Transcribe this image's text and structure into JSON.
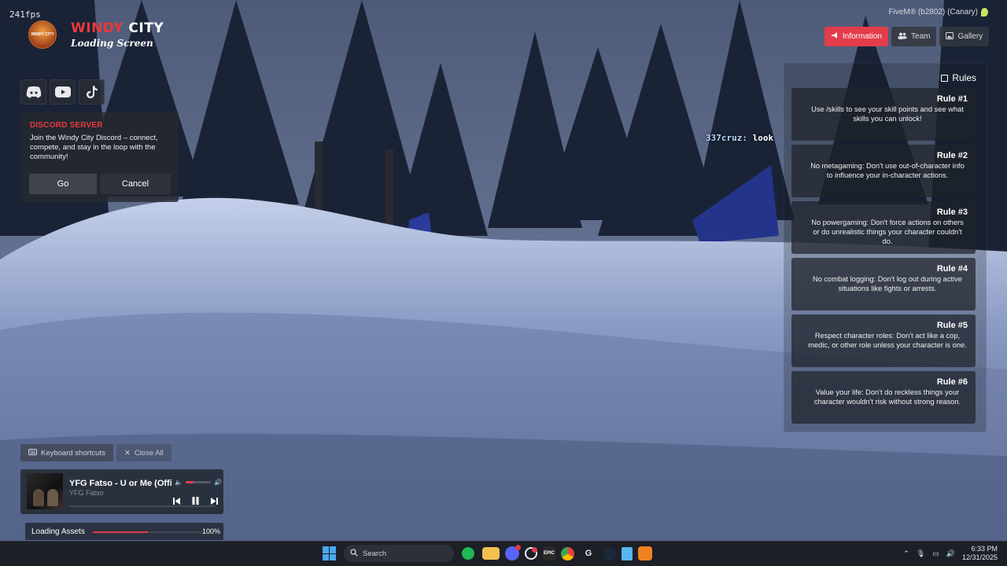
{
  "hud": {
    "fps": "241fps"
  },
  "brand": {
    "logo_text": "WINDY CITY",
    "title_part1": "WINDY",
    "title_part2": " CITY",
    "subtitle": "Loading Screen"
  },
  "socials": [
    "discord-icon",
    "youtube-icon",
    "tiktok-icon"
  ],
  "discord_card": {
    "heading": "DISCORD SERVER",
    "body": "Join the Windy City Discord – connect, compete, and stay in the loop with the community!",
    "go_label": "Go",
    "cancel_label": "Cancel"
  },
  "chat": {
    "name": "337cruz:",
    "message": "look"
  },
  "window": {
    "title": "FiveM® (b2802) (Canary)"
  },
  "tabs": [
    {
      "label": "Information",
      "icon": "megaphone-icon",
      "active": true
    },
    {
      "label": "Team",
      "icon": "users-icon",
      "active": false
    },
    {
      "label": "Gallery",
      "icon": "image-icon",
      "active": false
    }
  ],
  "rules": {
    "title": "Rules",
    "items": [
      {
        "title": "Rule #1",
        "text": "Use /skills to see your skill points and see what skills you can unlock!"
      },
      {
        "title": "Rule #2",
        "text": "No metagaming: Don't use out-of-character info to influence your in-character actions."
      },
      {
        "title": "Rule #3",
        "text": "No powergaming: Don't force actions on others or do unrealistic things your character couldn't do."
      },
      {
        "title": "Rule #4",
        "text": "No combat logging: Don't log out during active situations like fights or arrests."
      },
      {
        "title": "Rule #5",
        "text": "Respect character roles: Don't act like a cop, medic, or other role unless your character is one."
      },
      {
        "title": "Rule #6",
        "text": "Value your life: Don't do reckless things your character wouldn't risk without strong reason."
      }
    ]
  },
  "toolbar": {
    "shortcuts_label": "Keyboard shortcuts",
    "close_all_label": "Close All"
  },
  "player": {
    "song_title": "YFG Fatso - U or Me (Official",
    "artist": "YFG Fatso",
    "volume": 0.3
  },
  "loading": {
    "label": "Loading Assets",
    "percent_text": "100%",
    "progress": 0.5
  },
  "taskbar": {
    "search_placeholder": "Search",
    "time": "6:33 PM",
    "date": "12/31/2025",
    "apps": [
      "spotify-icon",
      "folder-icon",
      "discord-icon",
      "app-icon",
      "epic-icon",
      "chrome-icon",
      "app2-icon",
      "steam-icon",
      "notepad-icon",
      "fivem-icon"
    ]
  },
  "colors": {
    "accent": "#e33c4a",
    "panel": "#1e222a"
  }
}
